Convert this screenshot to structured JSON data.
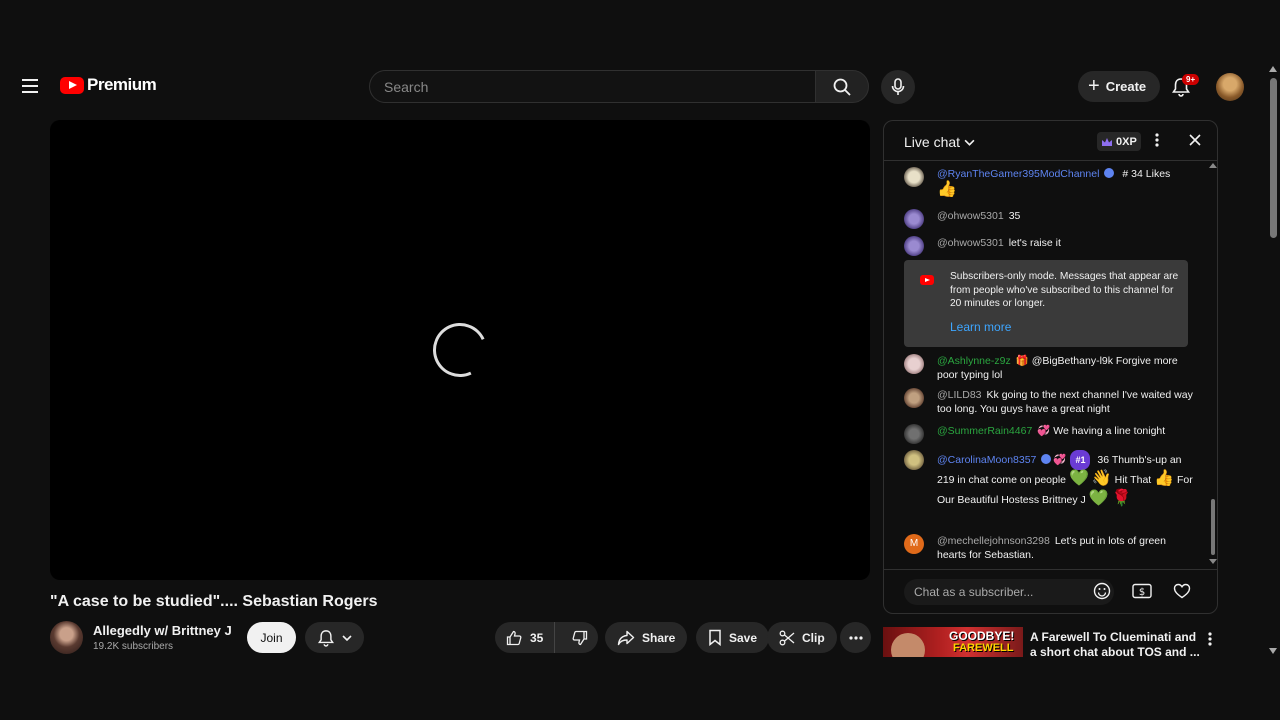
{
  "masthead": {
    "logo_text": "Premium",
    "search_placeholder": "Search",
    "create_label": "Create",
    "notification_badge": "9+"
  },
  "video": {
    "title": "\"A case to be studied\".... Sebastian Rogers",
    "channel_name": "Allegedly w/ Brittney J",
    "subscribers": "19.2K subscribers",
    "join_label": "Join",
    "like_count": "35",
    "share_label": "Share",
    "save_label": "Save",
    "clip_label": "Clip"
  },
  "chat": {
    "title": "Live chat",
    "xp_label": "0XP",
    "messages": [
      {
        "author": "@RyanTheGamer395ModChannel",
        "text": "# 34 Likes",
        "emoji": "👍"
      },
      {
        "author": "@ohwow5301",
        "text": "35"
      },
      {
        "author": "@ohwow5301",
        "text": "let's raise it"
      },
      {
        "author": "@Ashlynne-z9z",
        "emoji_badge": "🎁",
        "text": "@BigBethany-l9k Forgive more poor typing lol"
      },
      {
        "author": "@LILD83",
        "text": "Kk going to the next channel I've waited way too long. You guys have a great night"
      },
      {
        "author": "@SummerRain4467",
        "emoji_badge": "💞",
        "text": "We having a line tonight"
      },
      {
        "author": "@CarolinaMoon8357",
        "emoji_badge": "💞",
        "rank": "#1",
        "text_a": "36 Thumb's-up an 219 in chat come on people",
        "emoji_a": "💚",
        "emoji_b": "👋",
        "text_b": "Hit That",
        "emoji_c": "👍",
        "text_c": "For Our Beautiful Hostess Brittney J",
        "emoji_d": "💚",
        "emoji_e": "🌹"
      },
      {
        "author": "@mechellejohnson3298",
        "avatar_letter": "M",
        "text": "Let's put in lots of green hearts for Sebastian."
      }
    ],
    "notice": {
      "text": "Subscribers-only mode. Messages that appear are from people who've subscribed to this channel for 20 minutes or longer.",
      "link": "Learn more"
    },
    "input_placeholder": "Chat as a subscriber..."
  },
  "recommended": {
    "thumb_text_1": "GOODBYE!",
    "thumb_text_2": "FAREWELL",
    "title": "A Farewell To Clueminati and a short chat about TOS and ..."
  },
  "colors": {
    "background": "#0f0f0f",
    "brand_red": "#ff0000",
    "link_blue": "#3ea6ff",
    "mod_blue": "#5e84f1",
    "member_green": "#2ba640"
  }
}
